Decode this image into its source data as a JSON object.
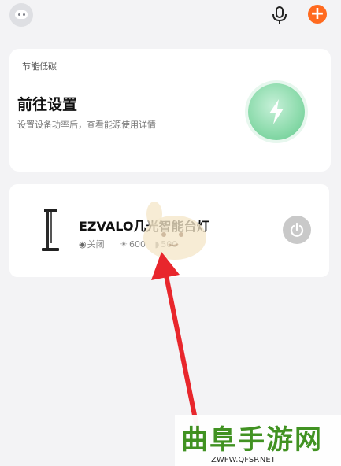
{
  "header": {
    "avatar_icon": "robot-avatar-icon",
    "mic_icon": "microphone-icon",
    "add_icon": "plus-icon",
    "add_label": "+",
    "accent_color": "#ff6a1f"
  },
  "energy_card": {
    "small_title": "节能低碳",
    "title": "前往设置",
    "description": "设置设备功率后，查看能源使用详情",
    "icon": "lightning-bolt-icon",
    "accent_color": "#63c98d"
  },
  "device_card": {
    "name": "EZVALO几光智能台灯",
    "status_label": "关闭",
    "brightness": "600",
    "color_temp": "500",
    "status_icon": "power-status-icon",
    "brightness_icon": "sun-icon",
    "color_temp_icon": "moon-icon",
    "power_button_icon": "power-icon"
  },
  "overlay": {
    "arrow_color": "#e8262c"
  },
  "watermark": {
    "title": "曲阜手游网",
    "url": "ZWFW.QFSP.NET"
  }
}
